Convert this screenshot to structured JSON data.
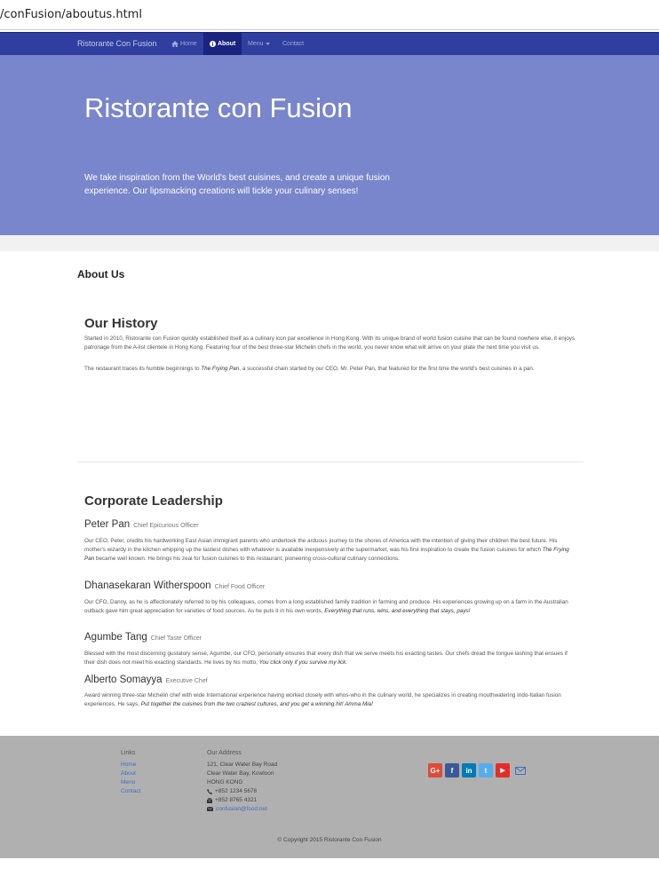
{
  "browser": {
    "url": "/conFusion/aboutus.html"
  },
  "navbar": {
    "brand": "Ristorante Con Fusion",
    "items": [
      {
        "label": "Home",
        "icon": "home-icon"
      },
      {
        "label": "About",
        "icon": "info-circle-icon"
      },
      {
        "label": "Menu",
        "icon": "caret-down-icon"
      },
      {
        "label": "Contact"
      }
    ],
    "colors": {
      "bar": "#303F9F",
      "active": "#1a237e"
    }
  },
  "jumbotron": {
    "title": "Ristorante con Fusion",
    "text": "We take inspiration from the World's best cuisines, and create a unique fusion experience. Our lipsmacking creations will tickle your culinary senses!",
    "color": "#7986CB"
  },
  "breadcrumb": {
    "title": "About Us"
  },
  "history": {
    "title": "Our History",
    "p1": "Started in 2010, Ristorante con Fusion quickly established itself as a culinary icon par excellence in Hong Kong. With its unique brand of world fusion cuisine that can be found nowhere else, it enjoys patronage from the A-list clientele in Hong Kong. Featuring four of the best three-star Michelin chefs in the world, you never know what will arrive on your plate the next time you visit us.",
    "p2_a": "The restaurant traces its humble beginnings to ",
    "p2_em": "The Frying Pan",
    "p2_b": ", a successful chain started by our CEO, Mr. Peter Pan, that featured for the first time the world's best cuisines in a pan."
  },
  "leadership": {
    "title": "Corporate Leadership",
    "people": [
      {
        "name": "Peter Pan",
        "role": "Chief Epicurious Officer",
        "text_a": "Our CEO, Peter, credits his hardworking East Asian immigrant parents who undertook the arduous journey to the shores of America with the intention of giving their children the best future. His mother's wizardy in the kitchen whipping up the tastiest dishes with whatever is available inexpensively at the supermarket, was his first inspiration to create the fusion cuisines for which ",
        "text_em": "The Frying Pan",
        "text_b": " became well known. He brings his zeal for fusion cuisines to this restaurant, pioneering cross-cultural culinary connections."
      },
      {
        "name": "Dhanasekaran Witherspoon",
        "role": "Chief Food Officer",
        "text_a": "Our CFO, Danny, as he is affectionately referred to by his colleagues, comes from a long established family tradition in farming and produce. His experiences growing up on a farm in the Australian outback gave him great appreciation for varieties of food sources. As he puts it in his own words, ",
        "text_em": "Everything that runs, wins, and everything that stays, pays!",
        "text_b": ""
      },
      {
        "name": "Agumbe Tang",
        "role": "Chief Taste Officer",
        "text_a": "Blessed with the most discerning gustatory sense, Agumbe, our CFO, personally ensures that every dish that we serve meets his exacting tastes. Our chefs dread the tongue lashing that ensues if their dish does not meet his exacting standards. He lives by his motto, ",
        "text_em": "You click only if you survive my lick.",
        "text_b": ""
      },
      {
        "name": "Alberto Somayya",
        "role": "Executive Chef",
        "text_a": "Award winning three-star Michelin chef with wide International experience having worked closely with whos-who in the culinary world, he specializes in creating mouthwatering Indo-Italian fusion experiences. He says, ",
        "text_em": "Put together the cuisines from the two craziest cultures, and you get a winning hit! Amma Mia!",
        "text_b": ""
      }
    ]
  },
  "footer": {
    "links_title": "Links",
    "links": [
      "Home",
      "About",
      "Menu",
      "Contact"
    ],
    "address_title": "Our Address",
    "address_lines": [
      "121, Clear Water Bay Road",
      "Clear Water Bay, Kowloon",
      "HONG KONG"
    ],
    "phone": "+852 1234 5678",
    "fax": "+852 8765 4321",
    "email": "confusion@food.net",
    "social": [
      {
        "icon": "google-plus-icon",
        "glyph": "G+",
        "color": "#dd4b39"
      },
      {
        "icon": "facebook-icon",
        "glyph": "f",
        "color": "#3b5998"
      },
      {
        "icon": "linkedin-icon",
        "glyph": "in",
        "color": "#007bb6"
      },
      {
        "icon": "twitter-icon",
        "glyph": "t",
        "color": "#55acee"
      },
      {
        "icon": "youtube-icon",
        "glyph": "▶",
        "color": "#e52d27"
      }
    ],
    "copyright": "© Copyright 2015 Ristorante Con Fusion"
  }
}
